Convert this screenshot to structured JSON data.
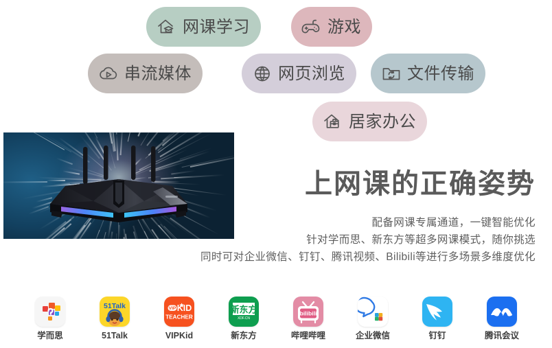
{
  "tags": [
    {
      "id": "class",
      "label": "网课学习",
      "icon": "house-graduation-cap-icon",
      "bg": "#b7cec3",
      "fg": "#4a4a4a"
    },
    {
      "id": "game",
      "label": "游戏",
      "icon": "gamepad-icon",
      "bg": "#ddb7bc",
      "fg": "#4a4a4a"
    },
    {
      "id": "stream",
      "label": "串流媒体",
      "icon": "cloud-play-icon",
      "bg": "#c4bdba",
      "fg": "#4a4a4a"
    },
    {
      "id": "web",
      "label": "网页浏览",
      "icon": "globe-icon",
      "bg": "#d4ceda",
      "fg": "#4a4a4a"
    },
    {
      "id": "file",
      "label": "文件传输",
      "icon": "folder-sync-icon",
      "bg": "#b6c7cd",
      "fg": "#4a4a4a"
    },
    {
      "id": "office",
      "label": "居家办公",
      "icon": "house-briefcase-icon",
      "bg": "#e9d6db",
      "fg": "#4a4a4a"
    }
  ],
  "hero": {
    "image_alt": "wireless-router-product-photo",
    "image_name": "asus-rgb-gaming-router"
  },
  "copy": {
    "headline": "上网课的正确姿势",
    "lines": [
      "配备网课专属通道，一键智能优化",
      "针对学而思、新东方等超多网课模式，随你挑选",
      "同时可对企业微信、钉钉、腾讯视频、Bilibili等进行多场景多维度优化"
    ]
  },
  "partners": [
    {
      "id": "xueersi",
      "name": "学而思",
      "logo": "xueersi-logo",
      "bg": "#f6f6f6"
    },
    {
      "id": "51talk",
      "name": "51Talk",
      "logo": "51talk-logo",
      "bg": "#fcd629"
    },
    {
      "id": "vipkid",
      "name": "VIPKid",
      "logo": "vipkid-logo",
      "bg": "#f6511f"
    },
    {
      "id": "xindongfang",
      "name": "新东方",
      "logo": "xindongfang-logo",
      "bg": "#0e9e4f"
    },
    {
      "id": "bilibili",
      "name": "哔哩哔哩",
      "logo": "bilibili-logo",
      "bg": "#e38ca5"
    },
    {
      "id": "wecom",
      "name": "企业微信",
      "logo": "wecom-logo",
      "bg": "#ffffff"
    },
    {
      "id": "dingtalk",
      "name": "钉钉",
      "logo": "dingtalk-logo",
      "bg": "#2eb4f2"
    },
    {
      "id": "tencentmeeting",
      "name": "腾讯会议",
      "logo": "tencent-meeting-logo",
      "bg": "#1b6ff0"
    }
  ],
  "theme": {
    "page_bg": "#ffffff",
    "headline_color": "#5a5a5a",
    "body_text_color": "#5e5e5e",
    "tag_text_color": "#4a4a4a"
  }
}
